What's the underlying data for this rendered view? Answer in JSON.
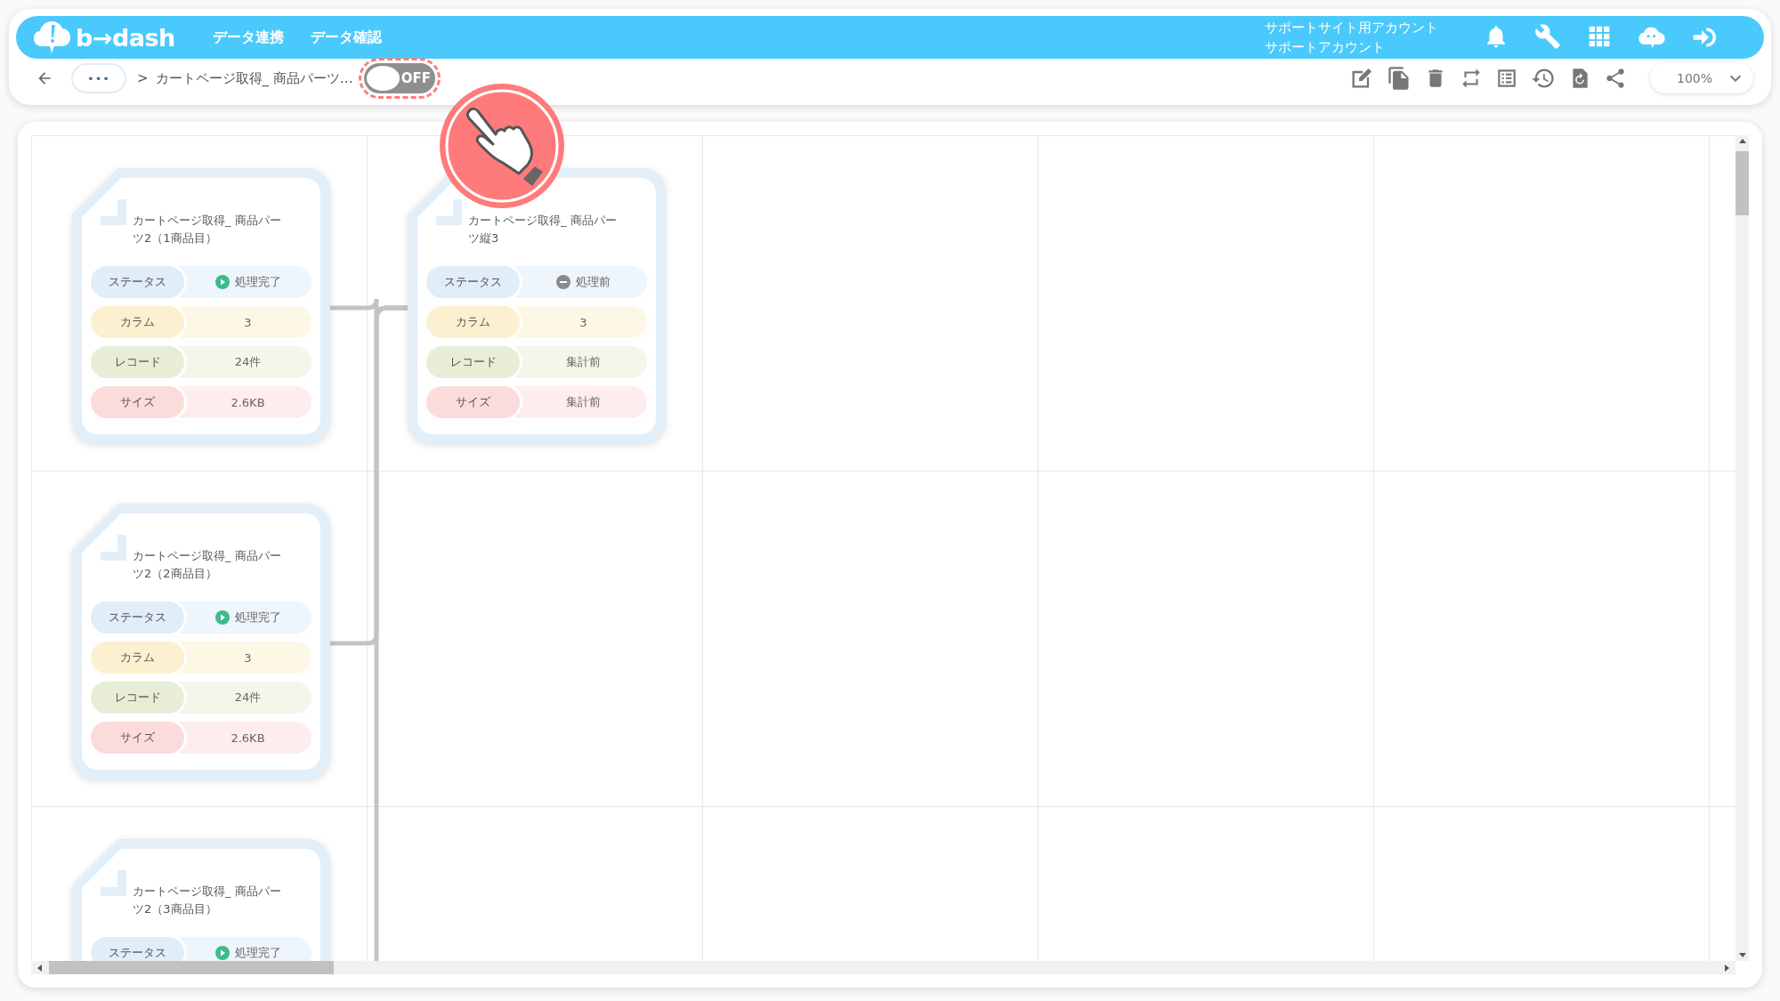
{
  "header": {
    "logo": "b→dash",
    "nav": [
      {
        "label": "データ連携"
      },
      {
        "label": "データ確認"
      }
    ],
    "account": {
      "line_1": "サポートサイト用アカウント",
      "line_2": "サポートアカウント"
    }
  },
  "toolbar": {
    "more": "•••",
    "separator": ">",
    "breadcrumb": "カートページ取得_ 商品パーツ…",
    "toggle": {
      "label": "OFF",
      "on": false
    },
    "zoom": "100%"
  },
  "flow": {
    "inputs": [
      {
        "title": "カートページ取得_ 商品パーツ2（1商品目）",
        "rows": [
          {
            "kind": "status",
            "label": "ステータス",
            "value": "処理完了",
            "done": true
          },
          {
            "kind": "column",
            "label": "カラム",
            "value": "3"
          },
          {
            "kind": "record",
            "label": "レコード",
            "value": "24件"
          },
          {
            "kind": "size",
            "label": "サイズ",
            "value": "2.6KB"
          }
        ]
      },
      {
        "title": "カートページ取得_ 商品パーツ2（2商品目）",
        "rows": [
          {
            "kind": "status",
            "label": "ステータス",
            "value": "処理完了",
            "done": true
          },
          {
            "kind": "column",
            "label": "カラム",
            "value": "3"
          },
          {
            "kind": "record",
            "label": "レコード",
            "value": "24件"
          },
          {
            "kind": "size",
            "label": "サイズ",
            "value": "2.6KB"
          }
        ]
      },
      {
        "title": "カートページ取得_ 商品パーツ2（3商品目）",
        "rows": [
          {
            "kind": "status",
            "label": "ステータス",
            "value": "処理完了",
            "done": true
          }
        ]
      }
    ],
    "output": {
      "title": "カートページ取得_ 商品パーツ縦3",
      "rows": [
        {
          "kind": "status",
          "label": "ステータス",
          "value": "処理前",
          "done": false
        },
        {
          "kind": "column",
          "label": "カラム",
          "value": "3"
        },
        {
          "kind": "record",
          "label": "レコード",
          "value": "集計前"
        },
        {
          "kind": "size",
          "label": "サイズ",
          "value": "集計前"
        }
      ]
    }
  }
}
